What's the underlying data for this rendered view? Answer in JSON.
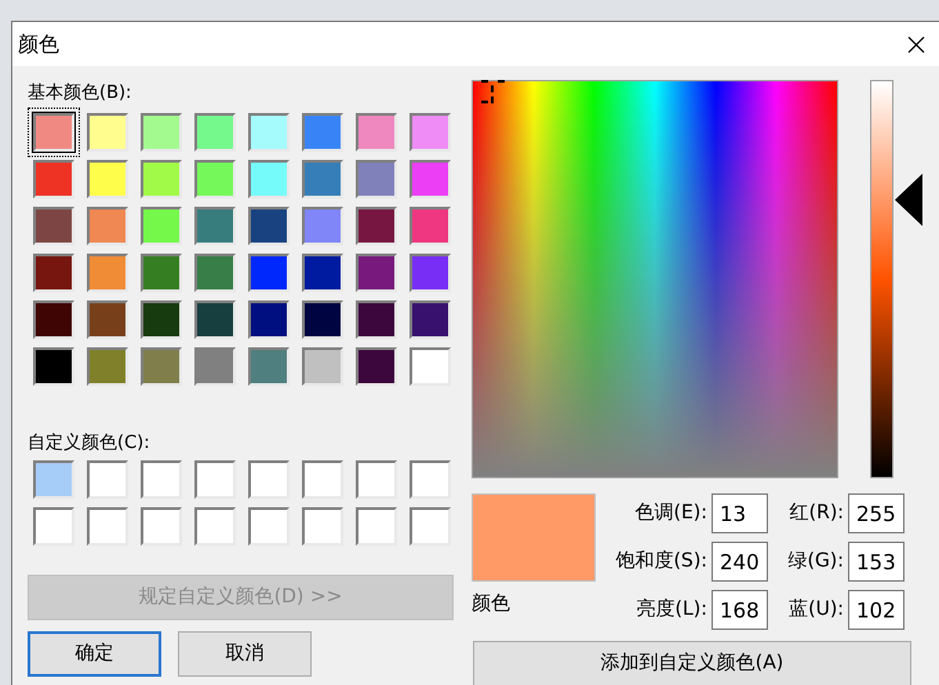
{
  "window": {
    "title": "颜色"
  },
  "basic_colors": {
    "label": "基本颜色(B):",
    "swatches": [
      {
        "color": "#f08982",
        "selected": true
      },
      {
        "color": "#fffd8e",
        "selected": false
      },
      {
        "color": "#a3fa8f",
        "selected": false
      },
      {
        "color": "#75f98c",
        "selected": false
      },
      {
        "color": "#a5fbfc",
        "selected": false
      },
      {
        "color": "#3884f7",
        "selected": false
      },
      {
        "color": "#ef88bf",
        "selected": false
      },
      {
        "color": "#ef8cf5",
        "selected": false
      },
      {
        "color": "#ee3324",
        "selected": false
      },
      {
        "color": "#fffd4c",
        "selected": false
      },
      {
        "color": "#a2fa48",
        "selected": false
      },
      {
        "color": "#74f85a",
        "selected": false
      },
      {
        "color": "#75fbfa",
        "selected": false
      },
      {
        "color": "#357eb7",
        "selected": false
      },
      {
        "color": "#8081bb",
        "selected": false
      },
      {
        "color": "#ec3ef5",
        "selected": false
      },
      {
        "color": "#7d4644",
        "selected": false
      },
      {
        "color": "#ef8853",
        "selected": false
      },
      {
        "color": "#75f84a",
        "selected": false
      },
      {
        "color": "#387d7e",
        "selected": false
      },
      {
        "color": "#184380",
        "selected": false
      },
      {
        "color": "#8085f7",
        "selected": false
      },
      {
        "color": "#771741",
        "selected": false
      },
      {
        "color": "#ee3780",
        "selected": false
      },
      {
        "color": "#77150f",
        "selected": false
      },
      {
        "color": "#f08b36",
        "selected": false
      },
      {
        "color": "#367e22",
        "selected": false
      },
      {
        "color": "#377e48",
        "selected": false
      },
      {
        "color": "#0027fb",
        "selected": false
      },
      {
        "color": "#001b9f",
        "selected": false
      },
      {
        "color": "#781a7d",
        "selected": false
      },
      {
        "color": "#782ef5",
        "selected": false
      },
      {
        "color": "#3f0504",
        "selected": false
      },
      {
        "color": "#78401a",
        "selected": false
      },
      {
        "color": "#173a0e",
        "selected": false
      },
      {
        "color": "#173f3f",
        "selected": false
      },
      {
        "color": "#000f80",
        "selected": false
      },
      {
        "color": "#000542",
        "selected": false
      },
      {
        "color": "#3b073d",
        "selected": false
      },
      {
        "color": "#38116f",
        "selected": false
      },
      {
        "color": "#000000",
        "selected": false
      },
      {
        "color": "#80802a",
        "selected": false
      },
      {
        "color": "#807e4a",
        "selected": false
      },
      {
        "color": "#808080",
        "selected": false
      },
      {
        "color": "#4f7f7e",
        "selected": false
      },
      {
        "color": "#c0c0c0",
        "selected": false
      },
      {
        "color": "#3c073d",
        "selected": false
      },
      {
        "color": "#ffffff",
        "selected": false
      }
    ]
  },
  "custom_colors": {
    "label": "自定义颜色(C):",
    "swatches": [
      {
        "color": "#a6cdf8"
      },
      {
        "color": "#ffffff"
      },
      {
        "color": "#ffffff"
      },
      {
        "color": "#ffffff"
      },
      {
        "color": "#ffffff"
      },
      {
        "color": "#ffffff"
      },
      {
        "color": "#ffffff"
      },
      {
        "color": "#ffffff"
      },
      {
        "color": "#ffffff"
      },
      {
        "color": "#ffffff"
      },
      {
        "color": "#ffffff"
      },
      {
        "color": "#ffffff"
      },
      {
        "color": "#ffffff"
      },
      {
        "color": "#ffffff"
      },
      {
        "color": "#ffffff"
      },
      {
        "color": "#ffffff"
      }
    ]
  },
  "define_custom_button": {
    "label": "规定自定义颜色(D) >>",
    "disabled": true
  },
  "buttons": [
    {
      "label": "确定",
      "default": true
    },
    {
      "label": "取消",
      "default": false
    }
  ],
  "preview": {
    "label": "颜色"
  },
  "hsl_fields": [
    {
      "label": "色调(E):",
      "value": "13"
    },
    {
      "label": "饱和度(S):",
      "value": "240"
    },
    {
      "label": "亮度(L):",
      "value": "168"
    }
  ],
  "rgb_fields": [
    {
      "label": "红(R):",
      "value": "255"
    },
    {
      "label": "绿(G):",
      "value": "153"
    },
    {
      "label": "蓝(U):",
      "value": "102"
    }
  ],
  "add_button": {
    "label": "添加到自定义颜色(A)"
  }
}
